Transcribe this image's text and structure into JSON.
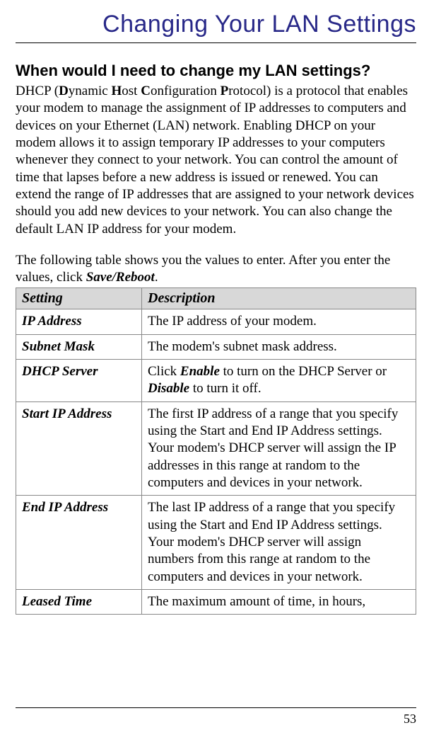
{
  "title": "Changing Your LAN Settings",
  "section_heading": "When would I need to change my LAN settings?",
  "para1_pre": "DHCP (",
  "para1_d": "D",
  "para1_t1": "ynamic ",
  "para1_h": "H",
  "para1_t2": "ost ",
  "para1_c": "C",
  "para1_t3": "onfiguration ",
  "para1_p": "P",
  "para1_rest": "rotocol) is a protocol that enables your modem to manage the assignment of IP addresses to computers and devices on your Ethernet (LAN) network. Enabling DHCP on your modem allows it to assign temporary IP addresses to your computers whenever they connect to your network. You can control the amount of time that lapses before a new address is issued or renewed. You can extend the range of IP addresses that are assigned to your network devices should you add new devices to your network. You can also change the default LAN IP address for your modem.",
  "para2_pre": "The following table shows you the values to enter. After you enter the values, click ",
  "para2_bold": "Save/Reboot",
  "para2_post": ".",
  "table": {
    "headers": {
      "c1": "Setting",
      "c2": "Description"
    },
    "rows": [
      {
        "name": "IP Address",
        "desc_pre": "The IP address of your modem.",
        "b1": "",
        "desc_mid": "",
        "b2": "",
        "desc_post": ""
      },
      {
        "name": "Subnet Mask",
        "desc_pre": "The modem's subnet mask address.",
        "b1": "",
        "desc_mid": "",
        "b2": "",
        "desc_post": ""
      },
      {
        "name": "DHCP Server",
        "desc_pre": "Click ",
        "b1": "Enable",
        "desc_mid": " to turn on the DHCP Server or ",
        "b2": "Disable",
        "desc_post": " to turn it off."
      },
      {
        "name": "Start IP Address",
        "desc_pre": "The first IP address of a range that you specify using the Start and End IP Address settings. Your modem's DHCP server will assign the IP addresses in this range at random to the computers and devices in your network.",
        "b1": "",
        "desc_mid": "",
        "b2": "",
        "desc_post": ""
      },
      {
        "name": "End IP Address",
        "desc_pre": "The last IP address of a range that you specify using the Start and End IP Address settings. Your modem's DHCP server will assign numbers from this range at random to the computers and devices in your network.",
        "b1": "",
        "desc_mid": "",
        "b2": "",
        "desc_post": ""
      },
      {
        "name": "Leased Time",
        "desc_pre": "The maximum amount of time, in hours,",
        "b1": "",
        "desc_mid": "",
        "b2": "",
        "desc_post": ""
      }
    ]
  },
  "page_number": "53"
}
